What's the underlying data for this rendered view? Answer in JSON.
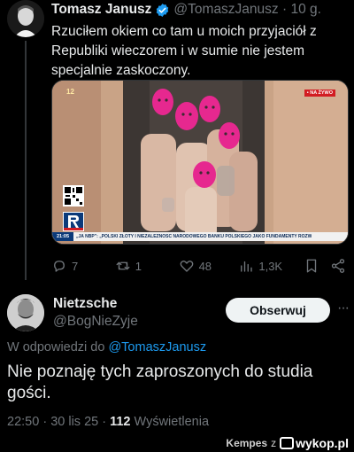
{
  "tweet1": {
    "author_name": "Tomasz Janusz",
    "handle": "@TomaszJanusz",
    "separator": "·",
    "time": "10 g.",
    "text": "Rzuciłem okiem co tam u moich przyjaciół z Republiki wieczorem i w sumie nie jestem specjalnie zaskoczony.",
    "media": {
      "channel_number": "12",
      "live_badge": "• NA ŻYWO",
      "ticker_time": "21:05",
      "ticker_text": "„JA NBP”: „POLSKI ZŁOTY I NIEZALEŻNOŚĆ NARODOWEGO BANKU POLSKIEGO JAKO FUNDAMENTY ROZW"
    },
    "actions": {
      "replies": "7",
      "retweets": "1",
      "likes": "48",
      "views": "1,3K"
    }
  },
  "tweet2": {
    "author_name": "Nietzsche",
    "handle": "@BogNieZyje",
    "follow_label": "Obserwuj",
    "more": "···",
    "reply_prefix": "W odpowiedzi do",
    "reply_mention": "@TomaszJanusz",
    "text": "Nie poznaję tych zaproszonych do studia gości.",
    "time": "22:50",
    "date": "30 lis 25",
    "views_count": "112",
    "views_label": "Wyświetlenia"
  },
  "watermark": {
    "user": "Kempes",
    "z": "z",
    "site": "wykop.pl"
  },
  "colors": {
    "background": "#000000",
    "text": "#e7e9ea",
    "muted": "#71767b",
    "link": "#1d9bf0",
    "verified": "#1d9bf0",
    "mask_pink": "#e6288f"
  }
}
